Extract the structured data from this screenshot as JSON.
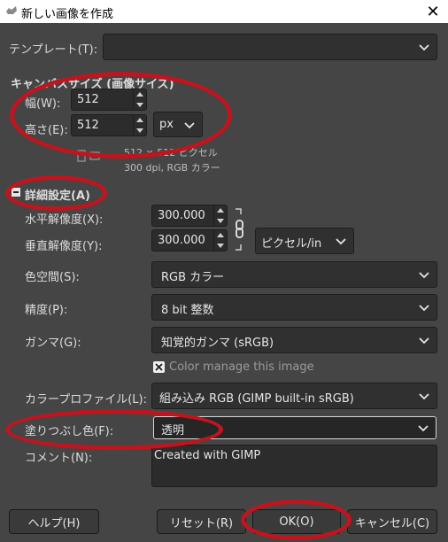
{
  "window": {
    "title": "新しい画像を作成",
    "close_glyph": "✕"
  },
  "template": {
    "label": "テンプレート(T):",
    "value": ""
  },
  "canvas_size": {
    "header": "キャンバスサイズ (画像サイズ)",
    "width_label": "幅(W):",
    "width_value": "512",
    "height_label": "高さ(E):",
    "height_value": "512",
    "unit": "px",
    "info_size": "512 × 512 ピクセル",
    "info_res": "300 dpi, RGB カラー"
  },
  "advanced": {
    "header": "詳細設定(A)",
    "xres_label": "水平解像度(X):",
    "xres_value": "300.000",
    "yres_label": "垂直解像度(Y):",
    "yres_value": "300.000",
    "res_unit": "ピクセル/in",
    "colorspace_label": "色空間(S):",
    "colorspace_value": "RGB カラー",
    "precision_label": "精度(P):",
    "precision_value": "8 bit 整数",
    "gamma_label": "ガンマ(G):",
    "gamma_value": "知覚的ガンマ (sRGB)",
    "color_manage_label": "Color manage this image",
    "profile_label": "カラープロファイル(L):",
    "profile_value": "組み込み RGB (GIMP built-in sRGB)",
    "fill_label": "塗りつぶし色(F):",
    "fill_value": "透明",
    "comment_label": "コメント(N):",
    "comment_value": "Created with GIMP"
  },
  "buttons": {
    "help": "ヘルプ(H)",
    "reset": "リセット(R)",
    "ok": "OK(O)",
    "cancel": "キャンセル(C)"
  },
  "colors": {
    "annotation": "#c0151f",
    "background": "#454545"
  }
}
